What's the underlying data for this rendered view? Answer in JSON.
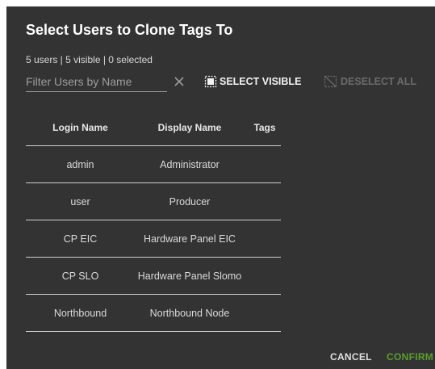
{
  "dialog": {
    "title": "Select Users to Clone Tags To",
    "summary": "5 users | 5 visible | 0 selected",
    "filter": {
      "placeholder": "Filter Users by Name",
      "value": ""
    },
    "select_visible_label": "SELECT VISIBLE",
    "deselect_all_label": "DESELECT ALL",
    "columns": {
      "login": "Login Name",
      "display": "Display Name",
      "tags": "Tags"
    },
    "rows": [
      {
        "login": "admin",
        "display": "Administrator",
        "tags": ""
      },
      {
        "login": "user",
        "display": "Producer",
        "tags": ""
      },
      {
        "login": "CP EIC",
        "display": "Hardware Panel EIC",
        "tags": ""
      },
      {
        "login": "CP SLO",
        "display": "Hardware Panel Slomo",
        "tags": ""
      },
      {
        "login": "Northbound",
        "display": "Northbound Node",
        "tags": ""
      }
    ],
    "cancel_label": "CANCEL",
    "confirm_label": "CONFIRM"
  },
  "colors": {
    "dialog_bg": "#333333",
    "text": "#e6e6e6",
    "disabled": "#6b6b6b",
    "confirm": "#5a9f2c"
  },
  "icons": {
    "clear": "close-icon",
    "select_visible": "select-all-icon",
    "deselect_all": "deselect-icon"
  }
}
